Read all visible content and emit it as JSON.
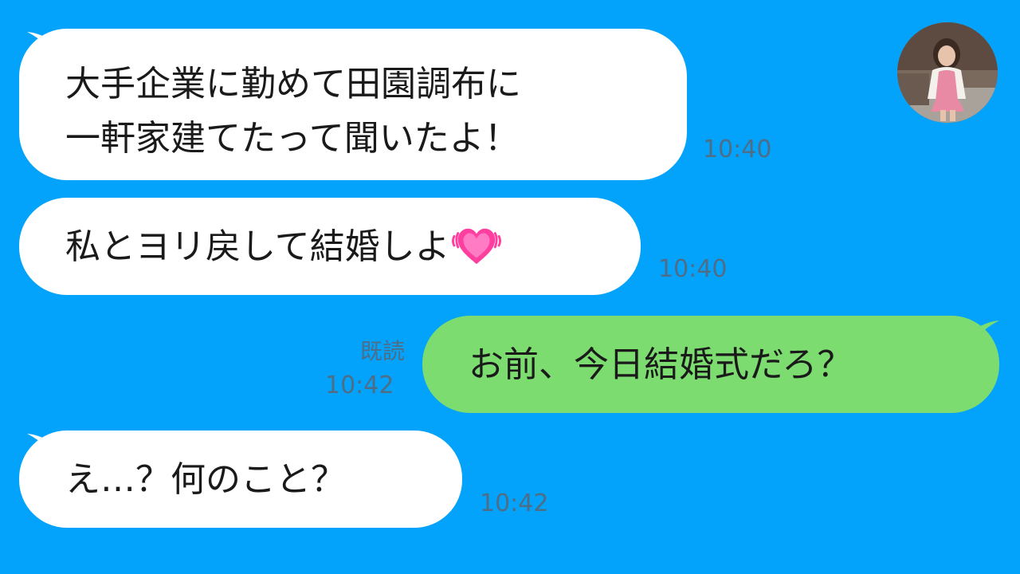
{
  "chat": {
    "messages": [
      {
        "side": "left",
        "lines": [
          "大手企業に勤めて田園調布に",
          "一軒家建てたって聞いたよ！"
        ],
        "time": "10:40"
      },
      {
        "side": "left",
        "text": "私とヨリ戻して結婚しよ",
        "time": "10:40",
        "emoji": "beating-heart-icon"
      },
      {
        "side": "right",
        "text": "お前、今日結婚式だろ？",
        "read_label": "既読",
        "time": "10:42"
      },
      {
        "side": "left",
        "text": "え…？何のこと？",
        "time": "10:42"
      }
    ]
  },
  "colors": {
    "background": "#03a2fb",
    "incoming_bubble": "#ffffff",
    "outgoing_bubble": "#7ddc70",
    "timestamp": "#4e6d86"
  }
}
